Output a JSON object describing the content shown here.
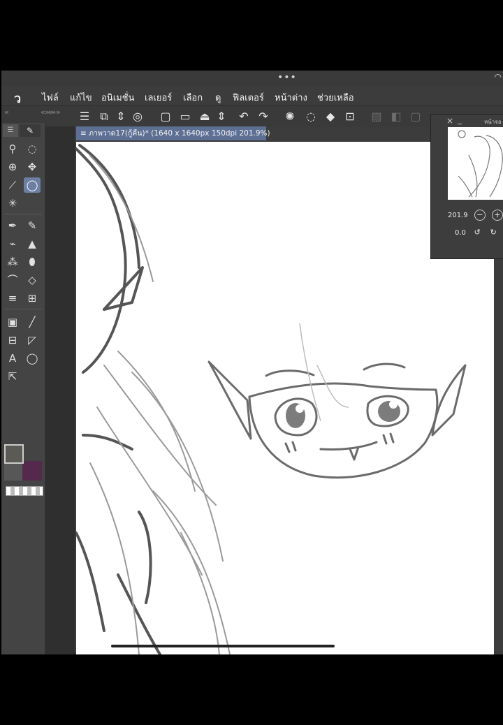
{
  "window": {
    "dots": "•••",
    "wifi": "◠"
  },
  "menu": {
    "logo": "ว",
    "items": [
      "ไฟล์",
      "แก้ไข",
      "อนิเมชั่น",
      "เลเยอร์",
      "เลือก",
      "ดู",
      "ฟิลเตอร์",
      "หน้าต่าง",
      "ช่วยเหลือ"
    ]
  },
  "toolbar": {
    "collapse": "« »»» »",
    "collapse_left": "«"
  },
  "document": {
    "tab_label": "≡ ภาพวาด17(กู้คืน)* (1640 x 1640px 150dpi 201.9%)"
  },
  "navigator": {
    "title": "หน้าจอ",
    "close": "×",
    "minimize": "_",
    "zoom_value": "201.9",
    "rotate_value": "0.0",
    "zoom_out": "−",
    "zoom_in": "+",
    "rotate_left": "↺",
    "rotate_right": "↻"
  },
  "colors": {
    "main": "#5b5a55",
    "sub": "#55294e",
    "tab_highlight": "#5d6f93",
    "selected_tool": "#6d7fa3"
  },
  "icons": [
    "menu-icon",
    "new-doc-icon",
    "open-icon",
    "save-icon",
    "undo-icon",
    "redo-icon",
    "zoom-icon",
    "lasso-icon",
    "move-icon",
    "eyedropper-icon",
    "pen-icon",
    "eraser-icon",
    "text-icon"
  ]
}
